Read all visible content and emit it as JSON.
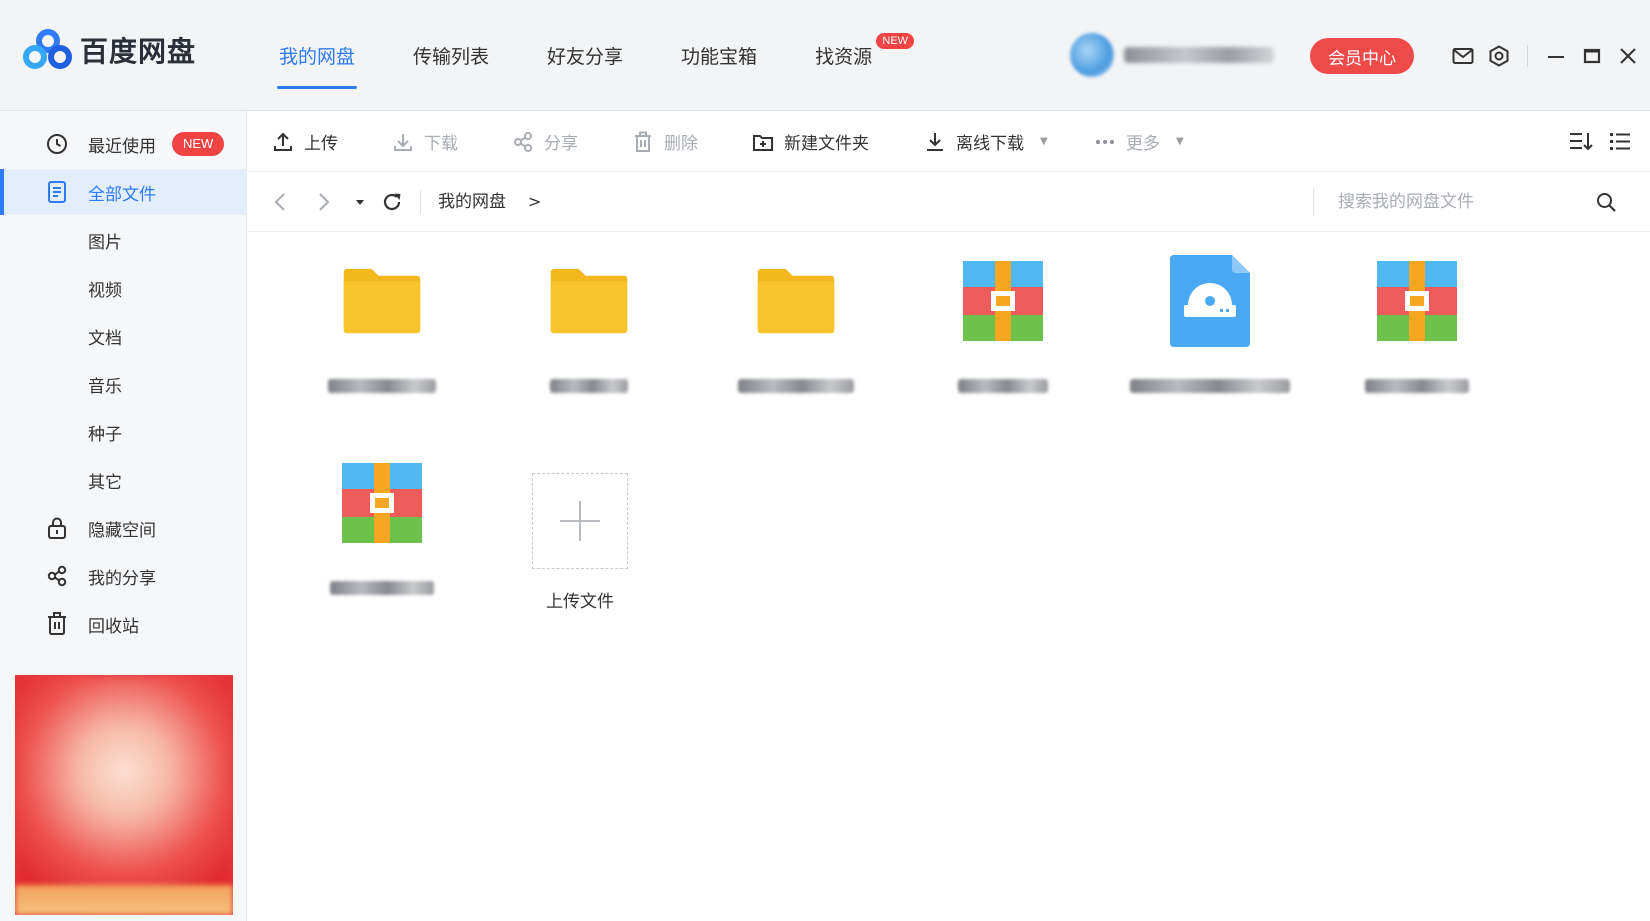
{
  "app": {
    "name": "百度网盘"
  },
  "nav": {
    "tabs": [
      {
        "label": "我的网盘",
        "active": true
      },
      {
        "label": "传输列表"
      },
      {
        "label": "好友分享"
      },
      {
        "label": "功能宝箱"
      },
      {
        "label": "找资源",
        "badge": "NEW"
      }
    ]
  },
  "header": {
    "vip_label": "会员中心"
  },
  "sidebar": {
    "items": [
      {
        "label": "最近使用",
        "badge": "NEW",
        "icon": "clock-icon"
      },
      {
        "label": "全部文件",
        "icon": "document-icon",
        "active": true
      },
      {
        "label": "图片"
      },
      {
        "label": "视频"
      },
      {
        "label": "文档"
      },
      {
        "label": "音乐"
      },
      {
        "label": "种子"
      },
      {
        "label": "其它"
      },
      {
        "label": "隐藏空间",
        "icon": "lock-icon"
      },
      {
        "label": "我的分享",
        "icon": "share-icon"
      },
      {
        "label": "回收站",
        "icon": "trash-icon"
      }
    ]
  },
  "toolbar": {
    "upload": "上传",
    "download": "下载",
    "share": "分享",
    "delete": "删除",
    "new_folder": "新建文件夹",
    "offline_download": "离线下载",
    "more": "更多"
  },
  "addressbar": {
    "breadcrumb": "我的网盘",
    "separator": ">",
    "search_placeholder": "搜索我的网盘文件"
  },
  "files": [
    {
      "type": "folder"
    },
    {
      "type": "folder"
    },
    {
      "type": "folder"
    },
    {
      "type": "archive"
    },
    {
      "type": "disc-image"
    },
    {
      "type": "archive"
    },
    {
      "type": "archive"
    }
  ],
  "upload_tile": {
    "label": "上传文件"
  },
  "colors": {
    "accent": "#2f7bf6",
    "badge_red": "#f04343",
    "vip_red": "#ee4a4a",
    "folder_yellow": "#f7c52b",
    "disc_blue": "#4aa9f2"
  }
}
